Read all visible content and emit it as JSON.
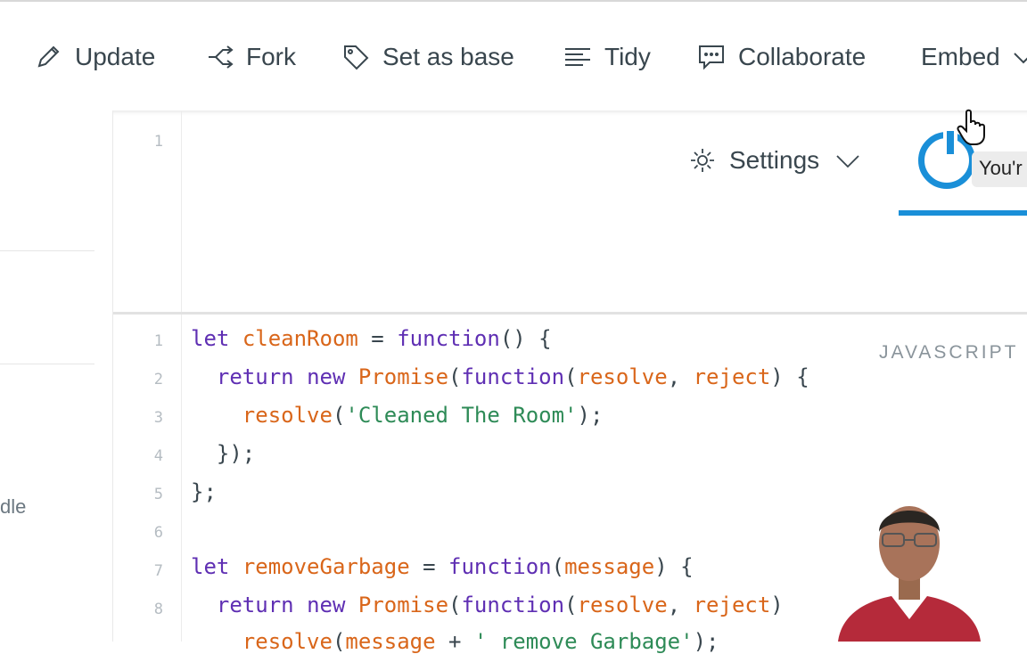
{
  "toolbar": {
    "update_label": "Update",
    "fork_label": "Fork",
    "set_base_label": "Set as base",
    "tidy_label": "Tidy",
    "collaborate_label": "Collaborate",
    "embed_label": "Embed"
  },
  "left_panel": {
    "partial_text": "dle"
  },
  "html_pane": {
    "line_number": "1"
  },
  "settings": {
    "label": "Settings"
  },
  "tooltip": {
    "text": "You'r"
  },
  "js_pane": {
    "language_label": "JAVASCRIPT",
    "line_numbers": [
      "1",
      "2",
      "3",
      "4",
      "5",
      "6",
      "7",
      "8"
    ],
    "lines": [
      "let cleanRoom = function() {",
      "  return new Promise(function(resolve, reject) {",
      "    resolve('Cleaned The Room');",
      "  });",
      "};",
      "",
      "let removeGarbage = function(message) {",
      "  return new Promise(function(resolve, reject)",
      "    resolve(message + ' remove Garbage');"
    ]
  },
  "colors": {
    "accent": "#1a8fd8",
    "keyword": "#5f2fb3",
    "function": "#d9661a",
    "string": "#2e8b57"
  }
}
